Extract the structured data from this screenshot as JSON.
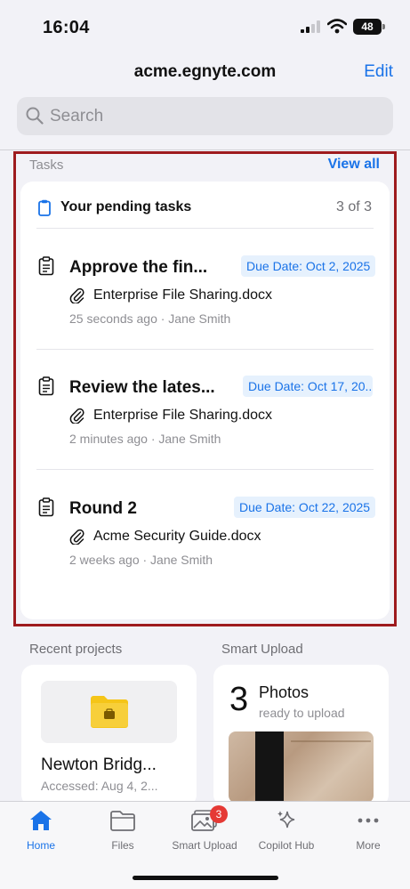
{
  "status_bar": {
    "time": "16:04",
    "battery": "48"
  },
  "header": {
    "title": "acme.egnyte.com",
    "edit_label": "Edit"
  },
  "search": {
    "placeholder": "Search"
  },
  "tasks": {
    "section_label": "Tasks",
    "view_all_label": "View all",
    "card_title": "Your pending tasks",
    "count": "3 of 3",
    "items": [
      {
        "title": "Approve the fin...",
        "due": "Due Date: Oct 2, 2025",
        "file": "Enterprise File Sharing.docx",
        "meta": "25 seconds ago · Jane Smith"
      },
      {
        "title": "Review the lates...",
        "due": "Due Date: Oct 17, 20...",
        "file": "Enterprise File Sharing.docx",
        "meta": "2 minutes ago · Jane Smith"
      },
      {
        "title": "Round 2",
        "due": "Due Date: Oct 22, 2025",
        "file": "Acme Security Guide.docx",
        "meta": "2 weeks ago · Jane Smith"
      }
    ]
  },
  "recent_projects": {
    "label": "Recent projects",
    "items": [
      {
        "name": "Newton Bridg...",
        "accessed": "Accessed: Aug 4, 2..."
      }
    ]
  },
  "smart_upload": {
    "label": "Smart Upload",
    "count": "3",
    "title": "Photos",
    "subtitle": "ready to upload"
  },
  "tabbar": {
    "items": [
      {
        "label": "Home",
        "icon": "home-icon",
        "active": true
      },
      {
        "label": "Files",
        "icon": "folder-icon"
      },
      {
        "label": "Smart Upload",
        "icon": "photos-icon",
        "badge": "3"
      },
      {
        "label": "Copilot Hub",
        "icon": "sparkle-icon"
      },
      {
        "label": "More",
        "icon": "more-icon"
      }
    ]
  },
  "colors": {
    "accent": "#1a73e8",
    "highlight_border": "#9e1b1e",
    "badge": "#e53935",
    "folder": "#f5c518"
  }
}
